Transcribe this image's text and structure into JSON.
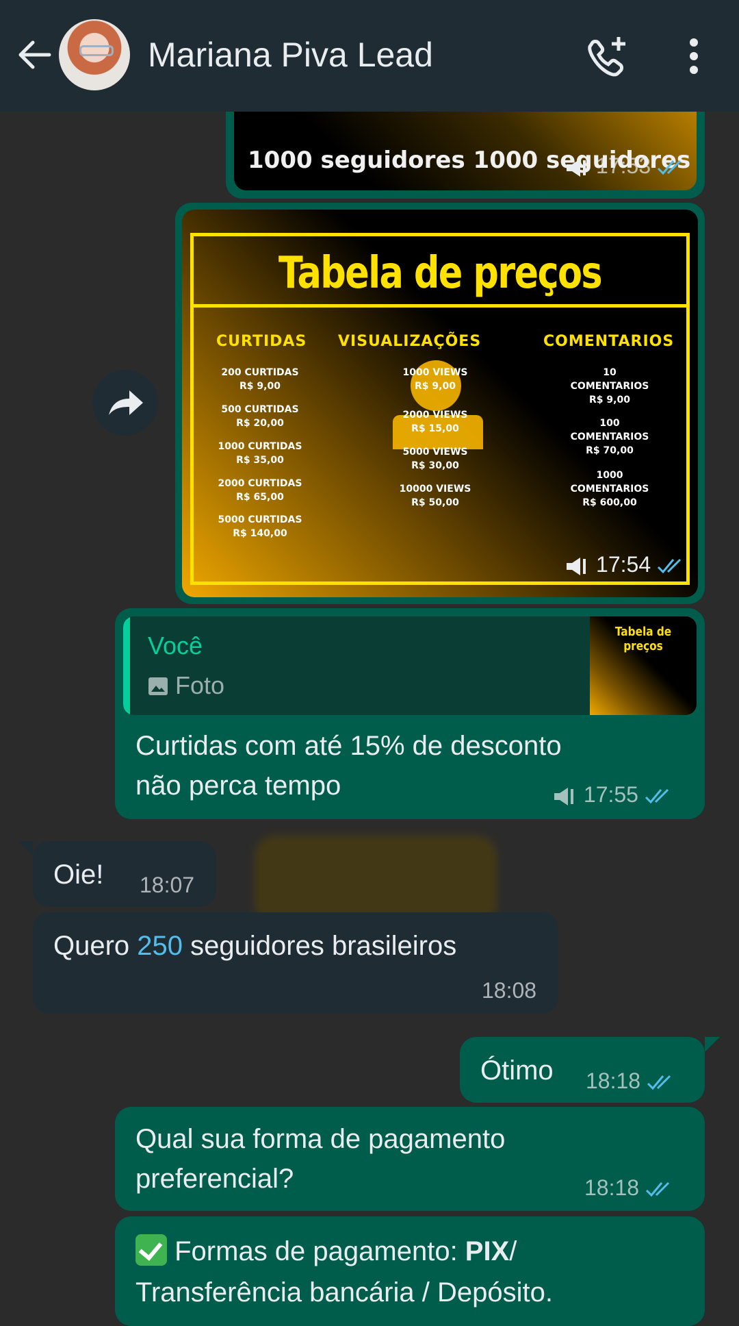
{
  "header": {
    "contact_name": "Mariana Piva Lead",
    "back_icon": "arrow-left-icon",
    "call_icon": "add-call-icon",
    "menu_icon": "more-vert-icon",
    "background": "#1f2c34"
  },
  "messages": {
    "partial_image": {
      "caption_partial": "1000 seguidores   1000 seguidores",
      "time": "17:53"
    },
    "price_image": {
      "title": "Tabela de preços",
      "col_curtidas": "CURTIDAS",
      "col_visualizacoes": "VISUALIZAÇÕES",
      "col_comentarios": "COMENTARIOS",
      "curtidas": [
        "200 CURTIDAS\nR$ 9,00",
        "500 CURTIDAS\nR$ 20,00",
        "1000 CURTIDAS\nR$ 35,00",
        "2000 CURTIDAS\nR$ 65,00",
        "5000 CURTIDAS\nR$ 140,00"
      ],
      "views": [
        "1000 VIEWS\nR$ 9,00",
        "2000 VIEWS\nR$ 15,00",
        "5000 VIEWS\nR$ 30,00",
        "10000 VIEWS\nR$ 50,00"
      ],
      "comentarios": [
        "10\nCOMENTARIOS\nR$ 9,00",
        "100\nCOMENTARIOS\nR$ 70,00",
        "1000\nCOMENTARIOS\nR$ 600,00"
      ],
      "time": "17:54"
    },
    "reply": {
      "quote_author": "Você",
      "quote_type": "Foto",
      "quote_thumb_title": "Tabela de preços",
      "text_line1": "Curtidas com até 15% de desconto",
      "text_line2": "não perca tempo",
      "time": "17:55"
    },
    "in1": {
      "text": "Oie!",
      "time": "18:07"
    },
    "in2": {
      "text_before": "Quero ",
      "text_number": "250",
      "text_after": " seguidores brasileiros",
      "time": "18:08"
    },
    "out1": {
      "text": "Ótimo",
      "time": "18:18"
    },
    "out2": {
      "text_line1": "Qual sua forma de pagamento",
      "text_line2": "preferencial?",
      "time": "18:18"
    },
    "out3": {
      "text_prefix": "Formas de pagamento: ",
      "text_bold": "PIX",
      "text_suffix": "/",
      "text_line2": "Transferência bancária / Depósito."
    }
  },
  "colors": {
    "outgoing": "#005c4b",
    "incoming": "#1f2c34",
    "read_ticks": "#53bdeb",
    "accent_green": "#06cf9c"
  }
}
